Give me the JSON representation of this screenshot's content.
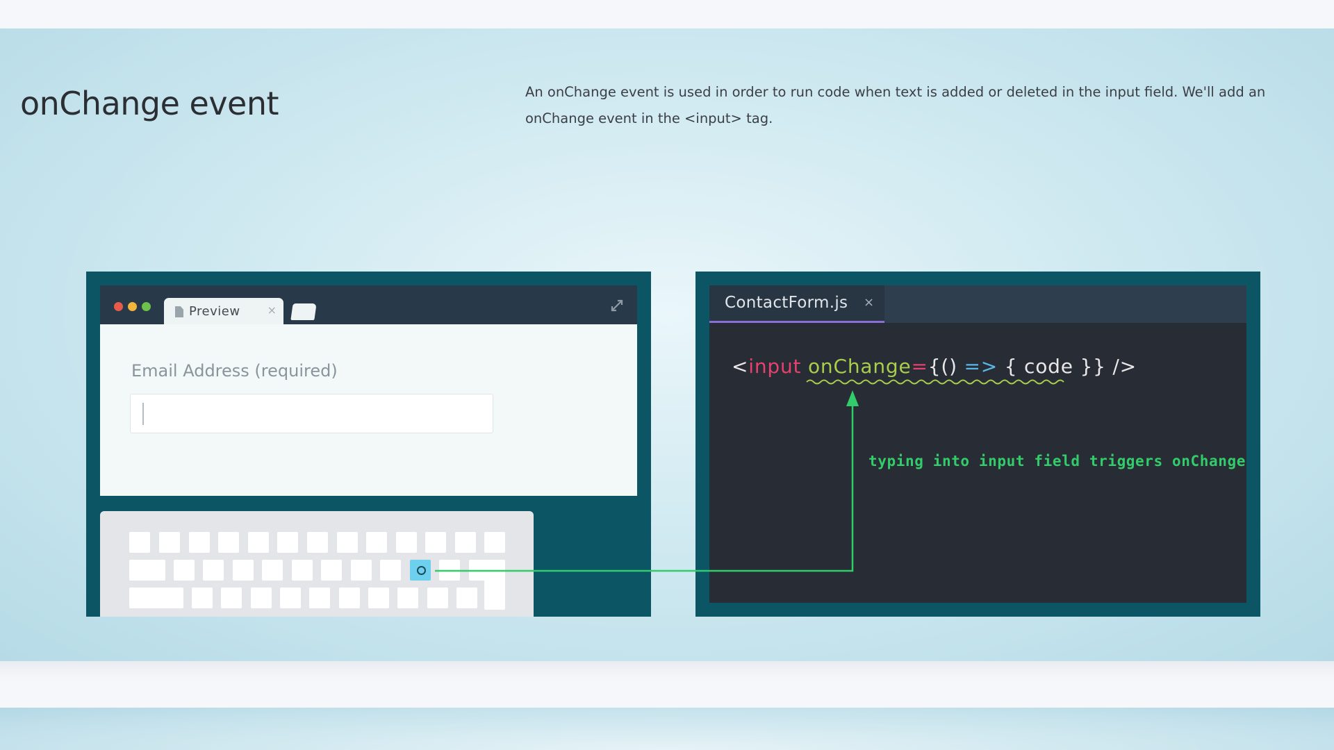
{
  "page": {
    "title": "onChange event",
    "description": "An onChange event is used in order to run code when text is added or deleted in the input field. We'll add an onChange event in the <input> tag."
  },
  "preview_window": {
    "tab_label": "Preview",
    "tab_close": "×",
    "field_label": "Email Address (required)",
    "field_value": ""
  },
  "editor_window": {
    "tab_label": "ContactForm.js",
    "tab_close": "×",
    "code": {
      "open_bracket": "<",
      "tag": "input",
      "space": " ",
      "attr": "onChange",
      "equals": "=",
      "expr_open": "{() ",
      "arrow": "=>",
      "body": " { code }} />"
    },
    "annotation": "typing into input field triggers onChange"
  },
  "colors": {
    "panel": "#0b5565",
    "editor_bg": "#282c34",
    "accent_green": "#33cc6a",
    "active_key": "#6dd0ef",
    "tab_underline": "#8a6fd6"
  }
}
